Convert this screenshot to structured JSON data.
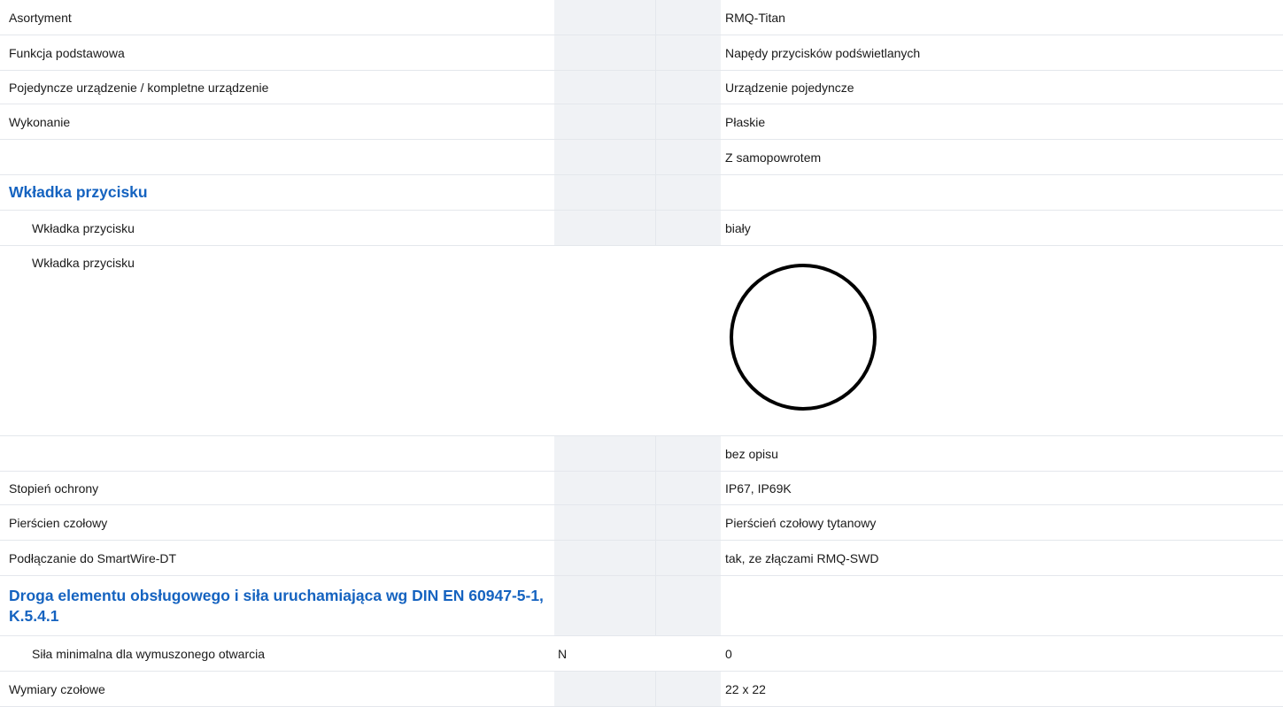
{
  "rows": [
    {
      "label": "Asortyment",
      "unit": "",
      "value": "RMQ-Titan"
    },
    {
      "label": "Funkcja podstawowa",
      "unit": "",
      "value": "Napędy przycisków podświetlanych"
    },
    {
      "label": "Pojedyncze urządzenie / kompletne urządzenie",
      "unit": "",
      "value": "Urządzenie pojedyncze"
    },
    {
      "label": "Wykonanie",
      "unit": "",
      "value": "Płaskie"
    },
    {
      "label": "",
      "unit": "",
      "value": "Z samopowrotem"
    },
    {
      "section": "Wkładka przycisku"
    },
    {
      "label": "Wkładka przycisku",
      "unit": "",
      "value": "biały"
    },
    {
      "label": "Wkładka przycisku",
      "unit": "",
      "value": "",
      "icon": "circle-icon"
    },
    {
      "label": "",
      "unit": "",
      "value": "bez opisu"
    },
    {
      "label": "Stopień ochrony",
      "unit": "",
      "value": "IP67, IP69K"
    },
    {
      "label": "Pierścien czołowy",
      "unit": "",
      "value": "Pierścień czołowy tytanowy"
    },
    {
      "label": "Podłączanie do SmartWire-DT",
      "unit": "",
      "value": "tak, ze złączami RMQ-SWD"
    },
    {
      "section": "Droga elementu obsługowego i siła uruchamiająca wg DIN EN 60947-5-1, K.5.4.1"
    },
    {
      "label": "Siła minimalna dla wymuszonego otwarcia",
      "unit": "N",
      "value": "0"
    },
    {
      "label": "Wymiary czołowe",
      "unit": "",
      "value": "22 x 22"
    }
  ]
}
